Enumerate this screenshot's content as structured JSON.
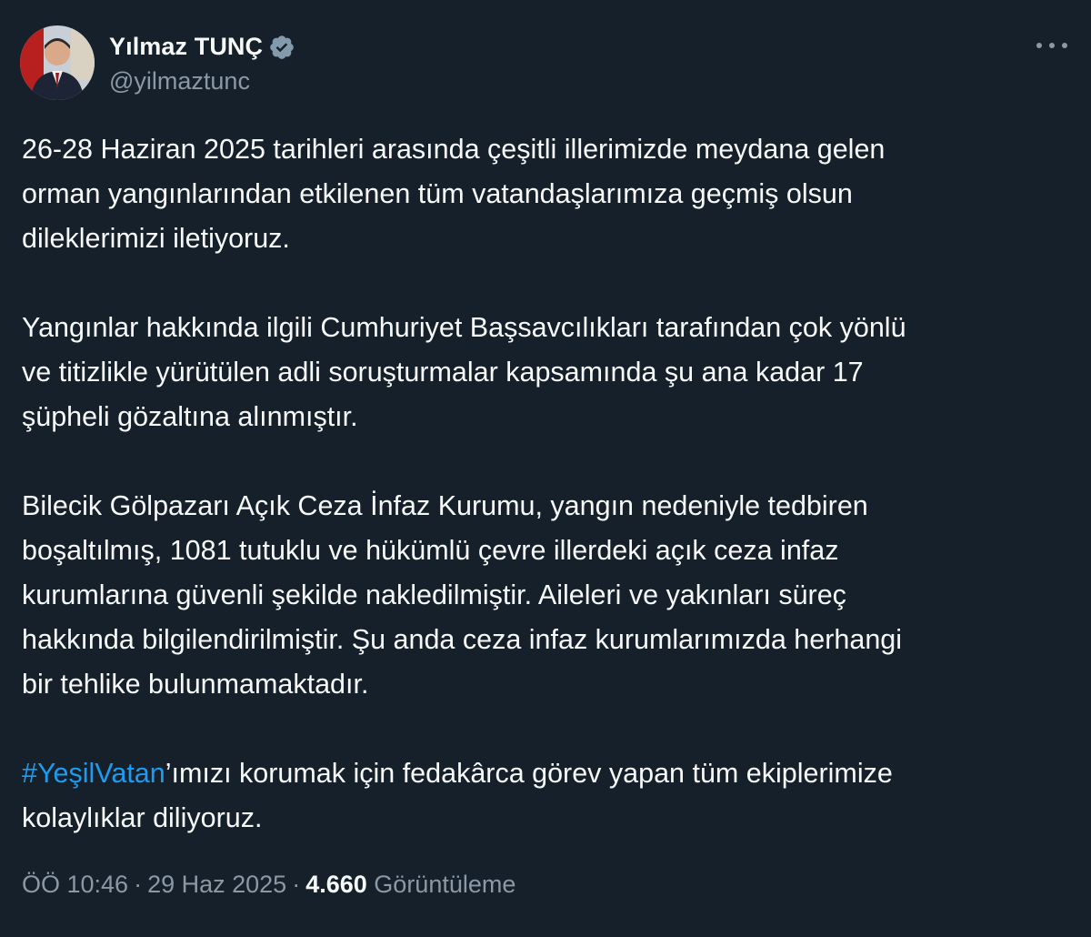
{
  "author": {
    "display_name": "Yılmaz TUNÇ",
    "handle": "@yilmaztunc",
    "verified_icon": "verified-badge-icon",
    "badge_color": "#829aab"
  },
  "more_icon": "more-horizontal-icon",
  "tweet": {
    "paragraphs": [
      {
        "lines": [
          "26-28 Haziran 2025 tarihleri arasında çeşitli illerimizde meydana gelen",
          "orman yangınlarından etkilenen tüm vatandaşlarımıza geçmiş olsun",
          "dileklerimizi iletiyoruz."
        ]
      },
      {
        "lines": [
          "Yangınlar hakkında ilgili Cumhuriyet Başsavcılıkları tarafından çok yönlü",
          "ve titizlikle yürütülen adli soruşturmalar kapsamında şu ana kadar 17",
          "şüpheli gözaltına alınmıştır."
        ]
      },
      {
        "lines": [
          "Bilecik Gölpazarı Açık Ceza İnfaz Kurumu, yangın nedeniyle tedbiren",
          "boşaltılmış, 1081 tutuklu ve hükümlü çevre illerdeki açık ceza infaz",
          "kurumlarına güvenli şekilde nakledilmiştir. Aileleri ve yakınları süreç",
          "hakkında bilgilendirilmiştir. Şu anda ceza infaz kurumlarımızda herhangi",
          "bir tehlike bulunmamaktadır."
        ]
      }
    ],
    "final_paragraph": {
      "hashtag": "#YeşilVatan",
      "line1_rest": "’ımızı korumak için fedakârca görev yapan tüm ekiplerimize",
      "line2": "kolaylıklar diliyoruz."
    }
  },
  "meta": {
    "time": "ÖÖ 10:46",
    "separator": "·",
    "date": "29 Haz 2025",
    "views_count": "4.660",
    "views_label": "Görüntüleme"
  },
  "colors": {
    "background": "#15202b",
    "text": "#f7f9f9",
    "secondary_text": "#8b98a5",
    "link": "#1d9bf0"
  }
}
